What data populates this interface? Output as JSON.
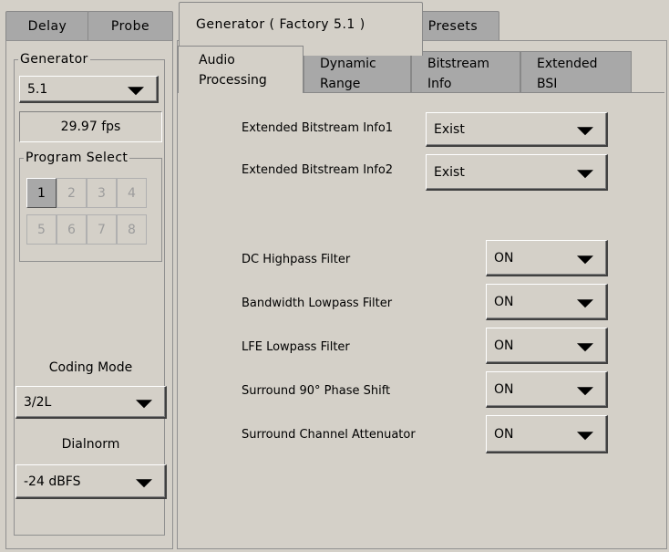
{
  "top_tabs": [
    {
      "label": "Delay"
    },
    {
      "label": "Probe"
    },
    {
      "label": "Generator ( Factory 5.1 )"
    },
    {
      "label": "Presets"
    }
  ],
  "left": {
    "generator_legend": "Generator",
    "generator_select": "5.1",
    "fps": "29.97 fps",
    "program_select_legend": "Program Select",
    "program_buttons": [
      "1",
      "2",
      "3",
      "4",
      "5",
      "6",
      "7",
      "8"
    ],
    "active_program": "1",
    "coding_mode_label": "Coding Mode",
    "coding_mode_value": "3/2L",
    "dialnorm_label": "Dialnorm",
    "dialnorm_value": "-24 dBFS"
  },
  "sub_tabs": [
    {
      "line1": "Audio",
      "line2": "Processing"
    },
    {
      "line1": "Dynamic",
      "line2": "Range"
    },
    {
      "line1": "Bitstream",
      "line2": "Info"
    },
    {
      "line1": "Extended",
      "line2": "BSI"
    }
  ],
  "settings": {
    "ebi1_label": "Extended Bitstream Info1",
    "ebi1_value": "Exist",
    "ebi2_label": "Extended Bitstream Info2",
    "ebi2_value": "Exist",
    "dc_label": "DC Highpass Filter",
    "dc_value": "ON",
    "bw_label": "Bandwidth Lowpass Filter",
    "bw_value": "ON",
    "lfe_label": "LFE Lowpass Filter",
    "lfe_value": "ON",
    "surround90_label": "Surround 90° Phase Shift",
    "surround90_value": "ON",
    "surround_att_label": "Surround Channel Attenuator",
    "surround_att_value": "ON"
  }
}
